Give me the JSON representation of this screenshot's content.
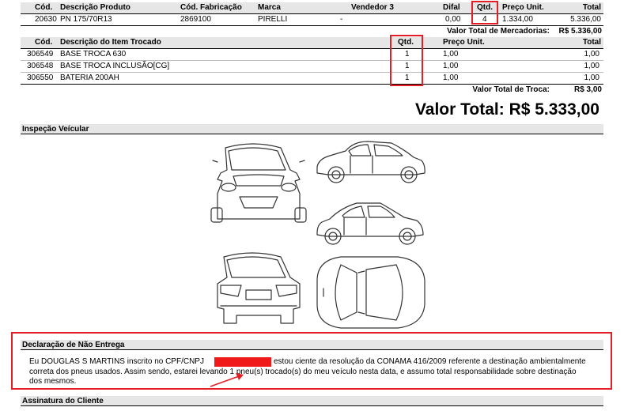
{
  "products": {
    "headers": {
      "cod": "Cód.",
      "descricao": "Descrição Produto",
      "fabricacao": "Cód. Fabricação",
      "marca": "Marca",
      "vendedor": "Vendedor 3",
      "difal": "Difal",
      "qtd": "Qtd.",
      "preco": "Preço Unit.",
      "total": "Total"
    },
    "rows": [
      {
        "cod": "20630",
        "descricao": "PN 175/70R13",
        "fabricacao": "2869100",
        "marca": "PIRELLI",
        "vendedor": "-",
        "difal": "0,00",
        "qtd": "4",
        "preco": "1.334,00",
        "total": "5.336,00"
      }
    ],
    "total_label": "Valor Total de Mercadorias:",
    "total_value": "R$ 5.336,00"
  },
  "trade": {
    "headers": {
      "cod": "Cód.",
      "descricao": "Descrição do Item Trocado",
      "qtd": "Qtd.",
      "preco": "Preço Unit.",
      "total": "Total"
    },
    "rows": [
      {
        "cod": "306549",
        "descricao": "BASE TROCA 630",
        "qtd": "1",
        "preco": "1,00",
        "total": "1,00"
      },
      {
        "cod": "306548",
        "descricao": "BASE TROCA INCLUSÃO[CG]",
        "qtd": "1",
        "preco": "1,00",
        "total": "1,00"
      },
      {
        "cod": "306550",
        "descricao": "BATERIA 200AH",
        "qtd": "1",
        "preco": "1,00",
        "total": "1,00"
      }
    ],
    "total_label": "Valor Total de Troca:",
    "total_value": "R$ 3,00"
  },
  "grand_total": "Valor Total: R$ 5.333,00",
  "inspection": {
    "title": "Inspeção Veícular"
  },
  "declaration": {
    "title": "Declaração de Não Entrega",
    "line1_a": "Eu DOUGLAS S MARTINS inscrito no CPF/CNPJ",
    "line1_b": "estou ciente da resolução da CONAMA 416/2009 referente a destinação ambientalmente",
    "line2": "correta dos pneus usados. Assim sendo, estarei levando 1 pneu(s) trocado(s) do meu veículo nesta data, e assumo total responsabilidade sobre destinação",
    "line3": "dos mesmos."
  },
  "signature": {
    "title": "Assinatura do Cliente"
  },
  "colors": {
    "highlight": "#e41e26",
    "header_bg": "#e6e6e6"
  }
}
